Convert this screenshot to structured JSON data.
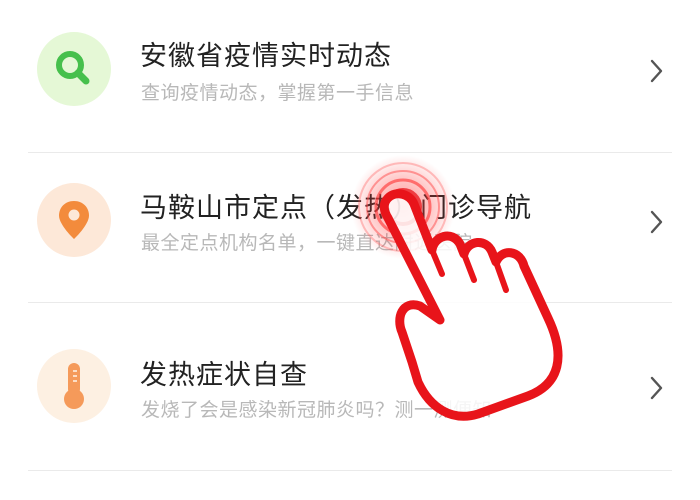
{
  "items": [
    {
      "title": "安徽省疫情实时动态",
      "subtitle": "查询疫情动态，掌握第一手信息",
      "icon": "search-icon",
      "icon_bg": "#e5f8d6",
      "icon_color": "#46c04c"
    },
    {
      "title": "马鞍山市定点（发热）门诊导航",
      "subtitle": "最全定点机构名单，一键直达附近医院",
      "icon": "location-pin-icon",
      "icon_bg": "#fde8d8",
      "icon_color": "#f38b3c"
    },
    {
      "title": "发热症状自查",
      "subtitle": "发烧了会是感染新冠肺炎吗？测一测便知",
      "icon": "thermometer-icon",
      "icon_bg": "#fdf0e2",
      "icon_color": "#f59a5a"
    }
  ],
  "chevron_icon": "chevron-right-icon",
  "tap_indicator": {
    "icon": "tap-hand-icon",
    "color": "#e8141a"
  }
}
